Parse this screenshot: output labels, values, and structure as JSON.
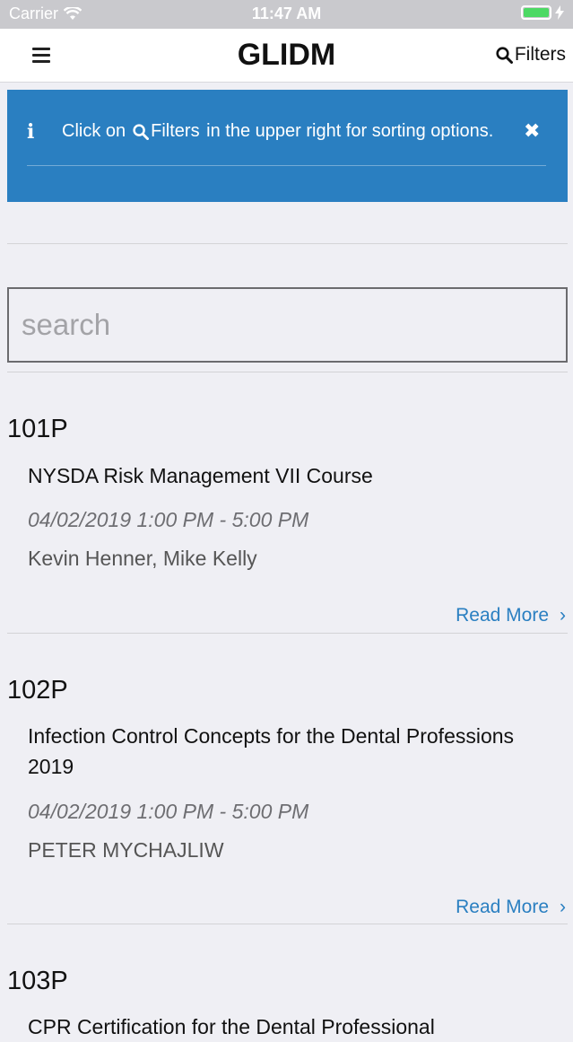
{
  "status_bar": {
    "carrier": "Carrier",
    "time": "11:47 AM",
    "wifi_icon": "wifi-icon",
    "battery_icon": "battery-icon",
    "battery_level": 1.0
  },
  "nav": {
    "title": "GLIDM",
    "filters_label": "Filters",
    "menu_icon": "hamburger-icon",
    "search_icon": "search-icon"
  },
  "alert": {
    "text_before": "Click on",
    "filters_word": "Filters",
    "text_after": " in the upper right for sorting options.",
    "info_icon": "info-icon",
    "close_icon": "close-icon",
    "background_color": "#2a7fc1"
  },
  "search": {
    "placeholder": "search",
    "value": ""
  },
  "courses": [
    {
      "code": "101P",
      "title": "NYSDA Risk Management VII Course",
      "datetime": "04/02/2019 1:00 PM - 5:00 PM",
      "instructors": "Kevin Henner, Mike Kelly",
      "read_more": "Read More"
    },
    {
      "code": "102P",
      "title": "Infection Control Concepts for the Dental Professions 2019",
      "datetime": "04/02/2019 1:00 PM - 5:00 PM",
      "instructors": "PETER MYCHAJLIW",
      "read_more": "Read More"
    },
    {
      "code": "103P",
      "title": "CPR Certification for the Dental Professional",
      "datetime": "",
      "instructors": "",
      "read_more": ""
    }
  ],
  "colors": {
    "accent": "#2a7fc1",
    "background": "#efeff4",
    "nav_background": "#ffffff"
  }
}
